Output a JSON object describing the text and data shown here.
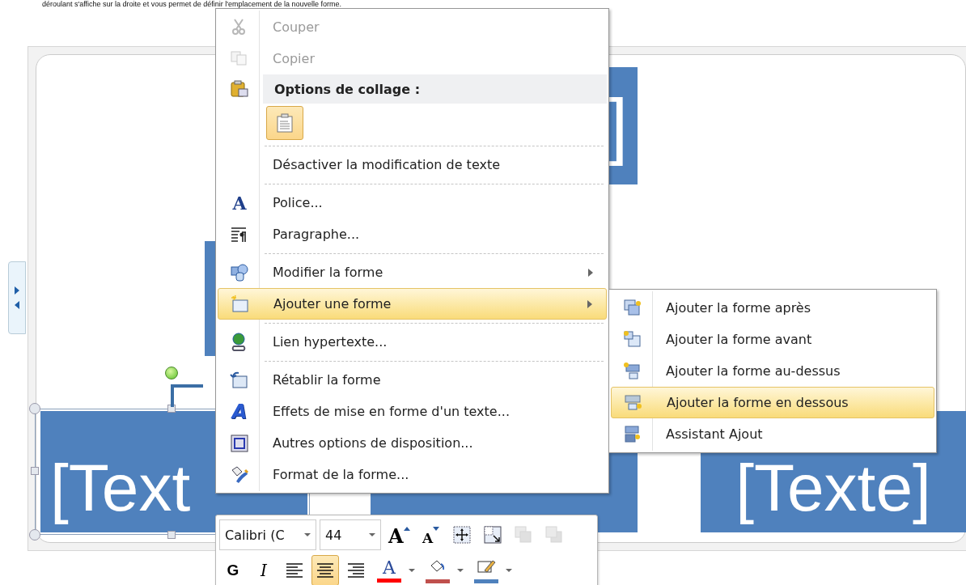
{
  "caption": "déroulant s'affiche sur la droite et vous permet de définir l'emplacement de la nouvelle forme.",
  "smartart": {
    "boxes": [
      {
        "kind": "top",
        "text": "]"
      },
      {
        "kind": "middle"
      },
      {
        "kind": "bottom",
        "text": "[Text",
        "selected": true
      },
      {
        "kind": "bottom",
        "selected": false
      },
      {
        "kind": "bottom",
        "text": "[Texte]",
        "selected": false
      }
    ]
  },
  "context_menu": {
    "items": [
      {
        "kind": "item",
        "label": "Couper",
        "disabled": true,
        "selected": false
      },
      {
        "kind": "item",
        "label": "Copier",
        "disabled": true,
        "selected": false
      },
      {
        "kind": "header",
        "label": "Options de collage :"
      },
      {
        "kind": "paste"
      },
      {
        "kind": "separator"
      },
      {
        "kind": "item",
        "label": "Désactiver la modification de texte",
        "disabled": false,
        "selected": false
      },
      {
        "kind": "separator"
      },
      {
        "kind": "item",
        "glyph": "A",
        "label": "Police...",
        "disabled": false,
        "selected": false
      },
      {
        "kind": "item",
        "label": "Paragraphe...",
        "disabled": false,
        "selected": false
      },
      {
        "kind": "separator"
      },
      {
        "kind": "item",
        "label": "Modifier la forme",
        "disabled": false,
        "selected": false,
        "submenu": true
      },
      {
        "kind": "item",
        "label": "Ajouter une forme",
        "disabled": false,
        "selected": true,
        "submenu": true
      },
      {
        "kind": "separator"
      },
      {
        "kind": "item",
        "label": "Lien hypertexte...",
        "disabled": false,
        "selected": false
      },
      {
        "kind": "separator"
      },
      {
        "kind": "item",
        "label": "Rétablir la forme",
        "disabled": false,
        "selected": false
      },
      {
        "kind": "item",
        "glyph": "A",
        "label": "Effets de mise en forme d'un texte...",
        "disabled": false,
        "selected": false
      },
      {
        "kind": "item",
        "label": "Autres options de disposition...",
        "disabled": false,
        "selected": false
      },
      {
        "kind": "item",
        "label": "Format de la forme...",
        "disabled": false,
        "selected": false
      }
    ]
  },
  "submenu": {
    "items": [
      {
        "label": "Ajouter la forme après",
        "selected": false
      },
      {
        "label": "Ajouter la forme avant",
        "selected": false
      },
      {
        "label": "Ajouter la forme au-dessus",
        "selected": false
      },
      {
        "label": "Ajouter la forme en dessous",
        "selected": true
      },
      {
        "label": "Assistant Ajout",
        "selected": false
      }
    ]
  },
  "mini_toolbar": {
    "font": "Calibri (C",
    "size": "44",
    "row1": [
      {
        "kind": "grow",
        "glyph": "A"
      },
      {
        "kind": "shrink",
        "glyph": "A"
      },
      {
        "kind": "select"
      },
      {
        "kind": "resize"
      },
      {
        "kind": "forward",
        "disabled": true
      },
      {
        "kind": "backward",
        "disabled": true
      }
    ],
    "row2": [
      {
        "kind": "bold",
        "glyph": "G",
        "selected": false
      },
      {
        "kind": "italic",
        "glyph": "I",
        "selected": false
      },
      {
        "kind": "left",
        "selected": false
      },
      {
        "kind": "center",
        "selected": true
      },
      {
        "kind": "right",
        "selected": false
      },
      {
        "kind": "fontcolor",
        "glyph": "A",
        "color": "#ff0000"
      },
      {
        "kind": "fill",
        "color": "#c0504d"
      },
      {
        "kind": "outline",
        "color": "#4f81bd"
      }
    ]
  }
}
